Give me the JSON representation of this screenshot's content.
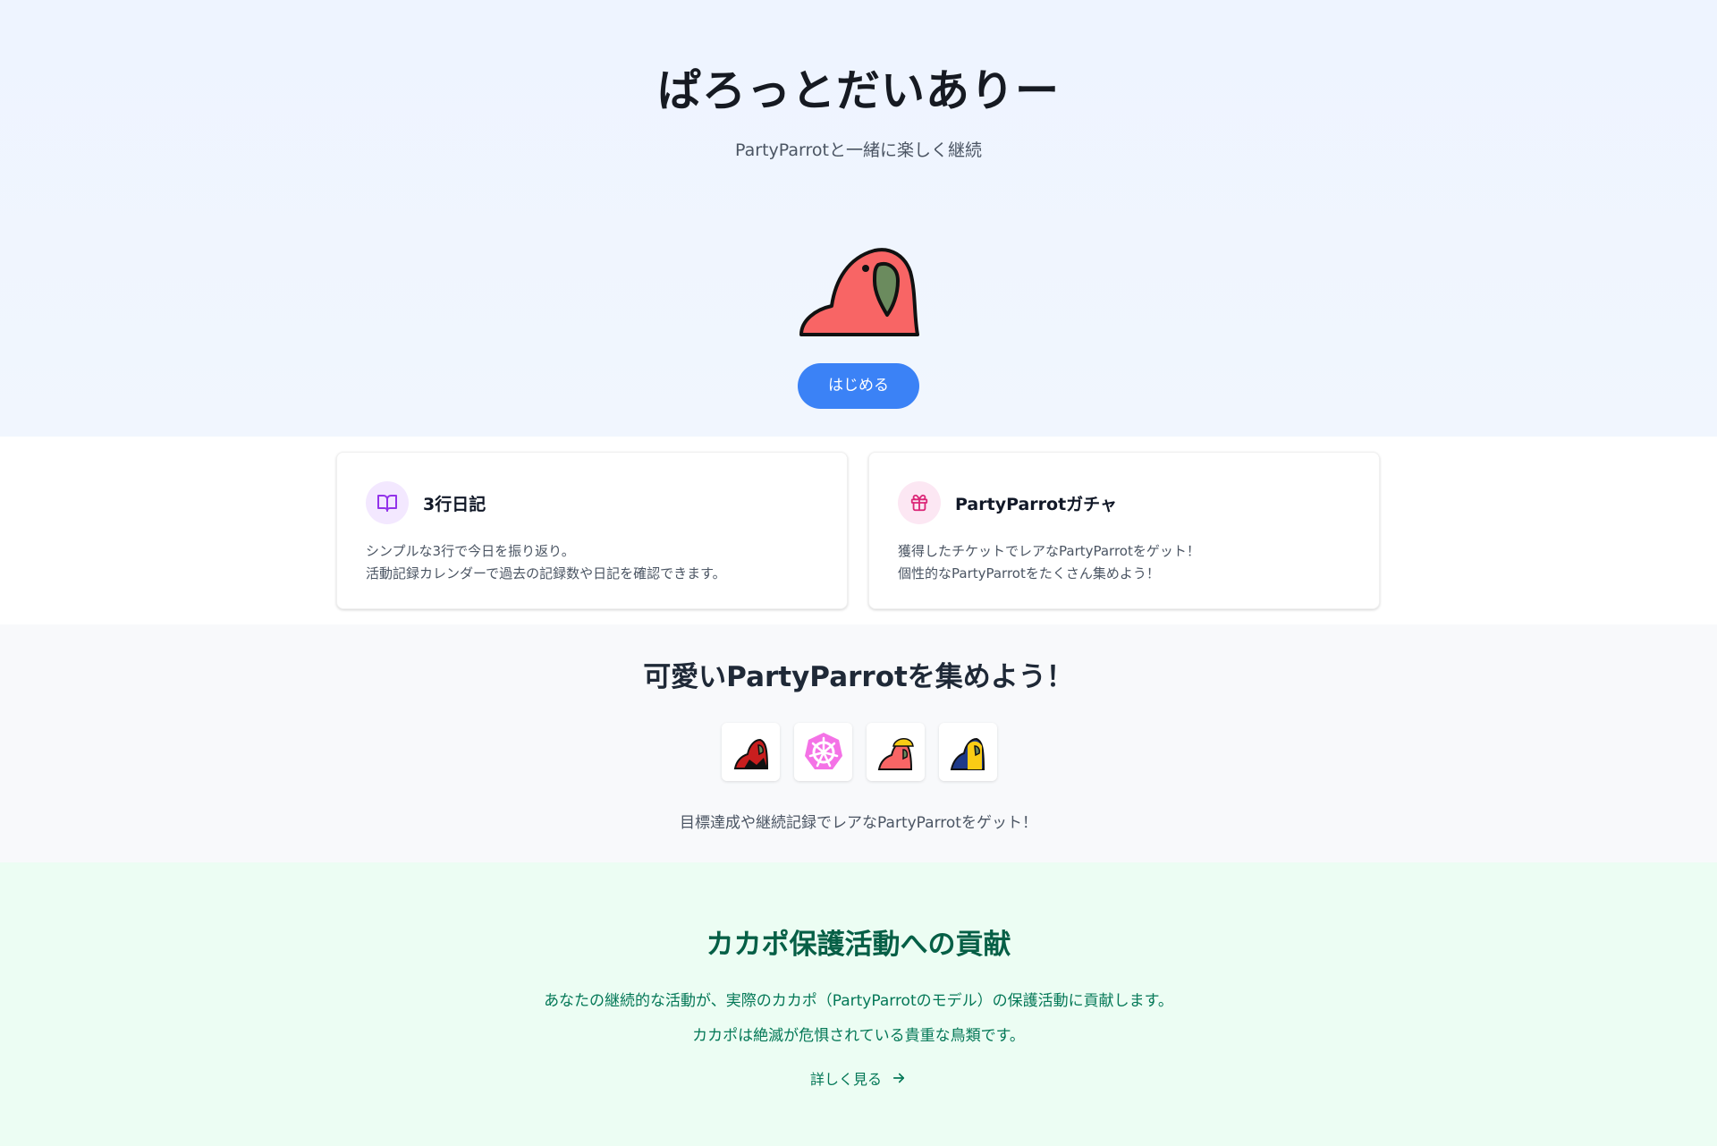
{
  "hero": {
    "title": "ぱろっとだいありー",
    "subtitle": "PartyParrotと一緒に楽しく継続",
    "start_button": "はじめる"
  },
  "features": [
    {
      "icon": "book-icon",
      "title": "3行日記",
      "lines": [
        "シンプルな3行で今日を振り返り。",
        "活動記録カレンダーで過去の記録数や日記を確認できます。"
      ]
    },
    {
      "icon": "gift-icon",
      "title": "PartyParrotガチャ",
      "lines": [
        "獲得したチケットでレアなPartyParrotをゲット！",
        "個性的なPartyParrotをたくさん集めよう！"
      ]
    }
  ],
  "collection": {
    "title": "可愛いPartyParrotを集めよう！",
    "note": "目標達成や継続記録でレアなPartyParrotをゲット！",
    "thumbnails": [
      "ruby-parrot-icon",
      "kubernetes-parrot-icon",
      "hardhat-parrot-icon",
      "blue-parrot-icon"
    ]
  },
  "kakapo": {
    "title": "カカポ保護活動への貢献",
    "line1": "あなたの継続的な活動が、実際のカカポ（PartyParrotのモデル）の保護活動に貢献します。",
    "line2": "カカポは絶滅が危惧されている貴重な鳥類です。",
    "link": "詳しく見る"
  },
  "colors": {
    "accent": "#3b82f6",
    "parrot_red": "#f86565",
    "parrot_beak": "#6b8b5e",
    "green_text": "#047857"
  }
}
